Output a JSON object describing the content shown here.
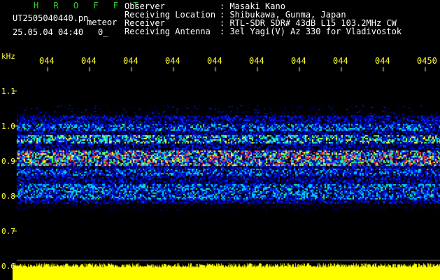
{
  "header": {
    "brand": "H R O F F T",
    "filename": "UT2505040440.pn",
    "kind": "meteor",
    "datetime": "25.05.04 04:40",
    "count": "0",
    "count_suffix": "_",
    "fields": [
      {
        "key": "Observer",
        "value": "Masaki Kano"
      },
      {
        "key": "Receiving Location",
        "value": "Shibukawa, Gunma, Japan"
      },
      {
        "key": "Receiver",
        "value": "RTL-SDR SDR# 43dB L15 103.2MHz CW"
      },
      {
        "key": "Receiving Antenna",
        "value": "3el Yagi(V) Az 330 for Vladivostok"
      }
    ]
  },
  "axis": {
    "unit": "kHz",
    "time_ticks": [
      "044",
      "044",
      "044",
      "044",
      "044",
      "044",
      "044",
      "044",
      "044",
      "0450"
    ],
    "freq_ticks": [
      "1.1",
      "1.0",
      "0.9",
      "0.8",
      "0.7",
      "0.6"
    ]
  },
  "colors": {
    "background": "#000000",
    "text": "#ffffff",
    "brand": "#33cc33",
    "axis": "#ffff33",
    "noise_low": "#0000aa",
    "noise_mid": "#00ccff",
    "noise_high": "#ff3333",
    "power_strip": "#ffff00"
  }
}
